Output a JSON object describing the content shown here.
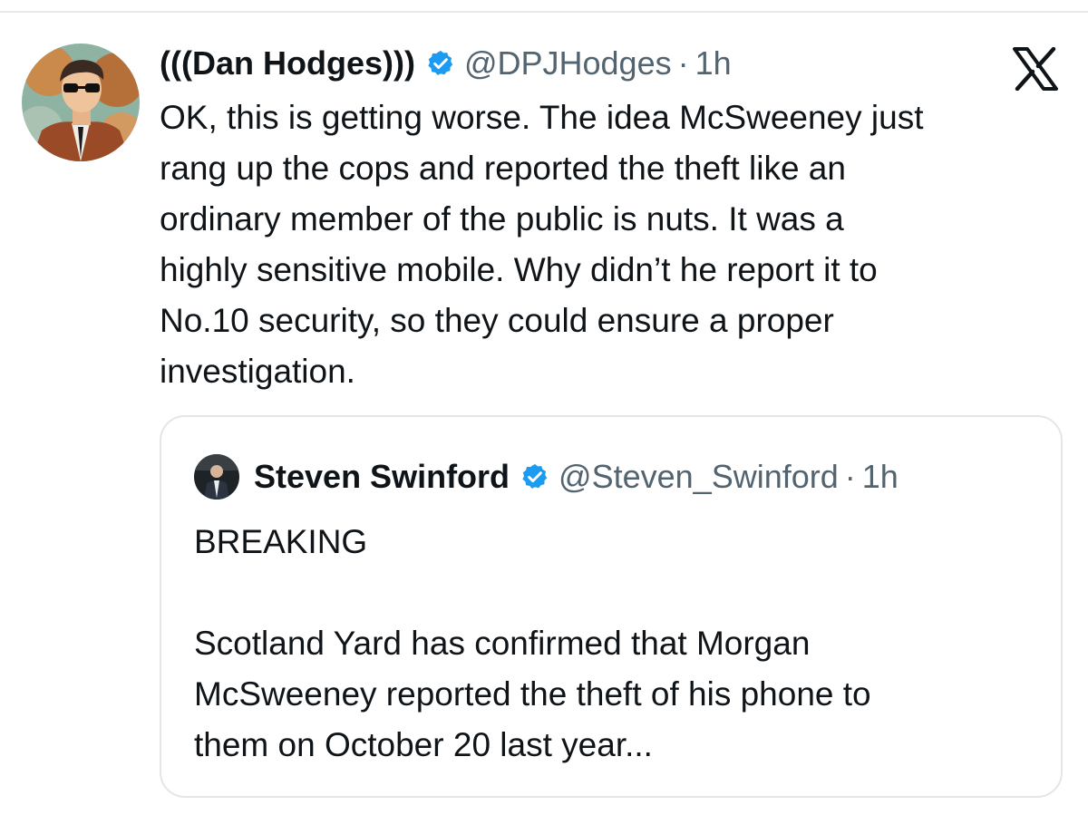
{
  "tweet": {
    "author_name": "(((Dan Hodges)))",
    "author_handle": "@DPJHodges",
    "separator": "·",
    "time": "1h",
    "text": "OK, this is getting worse. The idea McSweeney just\nrang up the cops and reported the theft like an\nordinary member of the public is nuts. It was a\nhighly sensitive mobile. Why didn’t he report it to\nNo.10 security, so they could ensure a proper\ninvestigation.",
    "verified": true
  },
  "quoted_tweet": {
    "author_name": "Steven Swinford",
    "author_handle": "@Steven_Swinford",
    "separator": "·",
    "time": "1h",
    "text": "BREAKING\n\nScotland Yard has confirmed that Morgan\nMcSweeney reported the theft of his phone to\nthem on October 20 last year...",
    "verified": true
  },
  "icons": {
    "verified": "verified-badge-icon",
    "platform_logo": "x-logo-icon"
  },
  "colors": {
    "text_primary": "#0f1419",
    "text_secondary": "#536471",
    "verified_blue": "#1d9bf0",
    "card_border": "#e3e6e8"
  }
}
